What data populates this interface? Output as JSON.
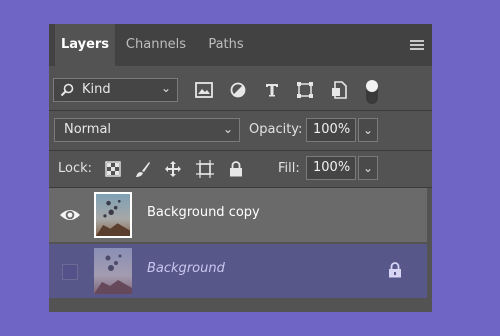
{
  "tabs": [
    {
      "label": "Layers",
      "active": true
    },
    {
      "label": "Channels",
      "active": false
    },
    {
      "label": "Paths",
      "active": false
    }
  ],
  "filter": {
    "kind_label": "Kind",
    "icons": [
      "image-filter-icon",
      "adjustment-filter-icon",
      "type-filter-icon",
      "shape-filter-icon",
      "smart-object-filter-icon"
    ],
    "filter_toggle_on": true
  },
  "blend": {
    "mode": "Normal",
    "opacity_label": "Opacity:",
    "opacity_value": "100%"
  },
  "lock": {
    "label": "Lock:",
    "icons": [
      "lock-transparent-pixels-icon",
      "lock-image-pixels-icon",
      "lock-position-icon",
      "lock-artboard-icon",
      "lock-all-icon"
    ],
    "fill_label": "Fill:",
    "fill_value": "100%"
  },
  "layers": [
    {
      "name": "Background copy",
      "visible": true,
      "selected": true,
      "locked": false
    },
    {
      "name": "Background",
      "visible": false,
      "selected": false,
      "locked": true
    }
  ],
  "colors": {
    "page_bg": "#6e65c4",
    "panel_bg": "#535353",
    "tab_bar": "#424242",
    "selected_layer": "#6a6a6a",
    "background_layer": "#58578a"
  }
}
